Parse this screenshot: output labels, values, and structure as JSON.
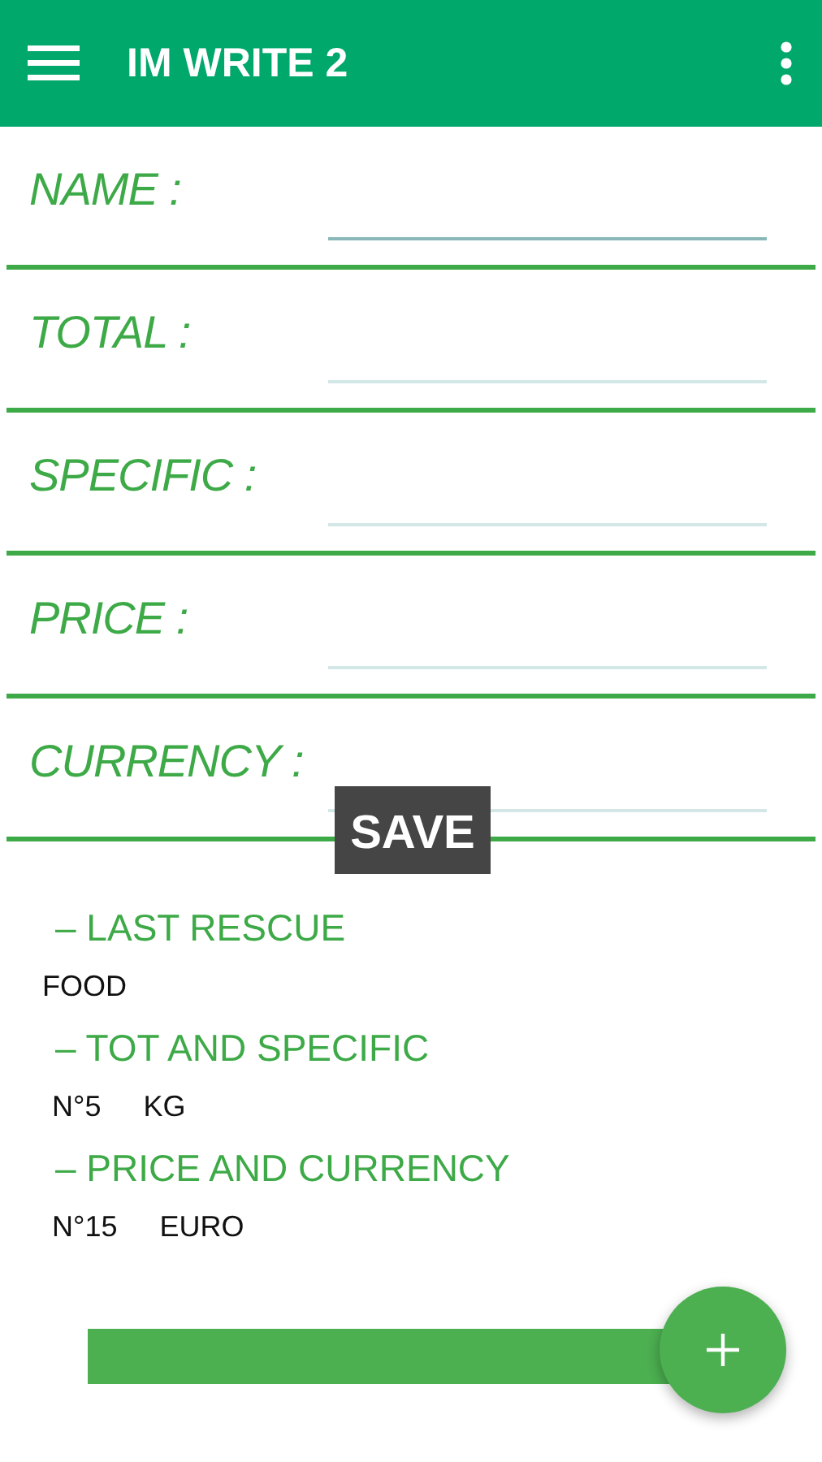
{
  "app_bar": {
    "title": "IM WRITE 2"
  },
  "form": {
    "fields": [
      {
        "label": "NAME :",
        "focused": true
      },
      {
        "label": "TOTAL :",
        "focused": false
      },
      {
        "label": "SPECIFIC :",
        "focused": false
      },
      {
        "label": "PRICE :",
        "focused": false
      },
      {
        "label": "CURRENCY :",
        "focused": false
      }
    ]
  },
  "tooltip": {
    "text": "SAVE"
  },
  "summary": [
    {
      "heading": "– LAST RESCUE",
      "values": [
        "FOOD"
      ]
    },
    {
      "heading": "– TOT AND SPECIFIC",
      "values": [
        "N°5",
        "KG"
      ]
    },
    {
      "heading": "– PRICE AND CURRENCY",
      "values": [
        "N°15",
        "EURO"
      ]
    }
  ]
}
